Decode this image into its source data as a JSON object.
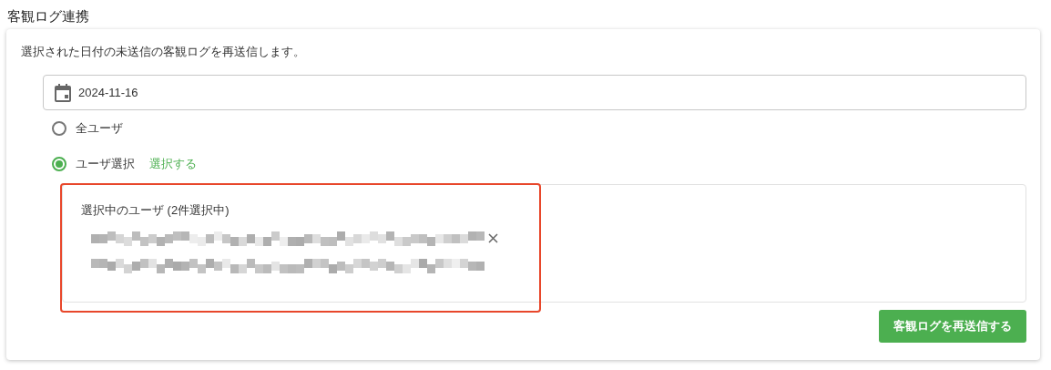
{
  "section_title": "客観ログ連携",
  "description": "選択された日付の未送信の客観ログを再送信します。",
  "date_field": {
    "value": "2024-11-16"
  },
  "user_options": [
    {
      "label": "全ユーザ",
      "selected": false
    },
    {
      "label": "ユーザ選択",
      "selected": true,
      "link": "選択する"
    }
  ],
  "selected_users": {
    "title": "選択中のユーザ (2件選択中)"
  },
  "submit_button": "客観ログを再送信する"
}
